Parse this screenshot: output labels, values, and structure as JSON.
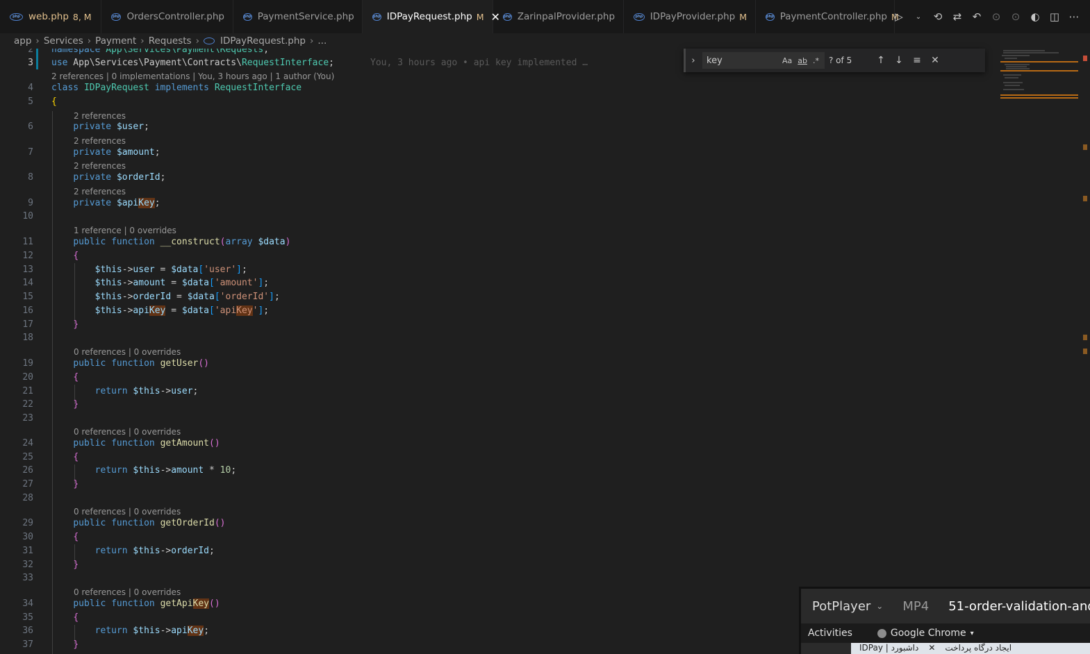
{
  "tabs": [
    {
      "title": "web.php",
      "modified": "8, M",
      "active": false,
      "mod_color": true
    },
    {
      "title": "OrdersController.php",
      "modified": "",
      "active": false
    },
    {
      "title": "PaymentService.php",
      "modified": "",
      "active": false
    },
    {
      "title": "IDPayRequest.php",
      "modified": "M",
      "active": true
    },
    {
      "title": "ZarinpalProvider.php",
      "modified": "",
      "active": false
    },
    {
      "title": "IDPayProvider.php",
      "modified": "M",
      "active": false
    },
    {
      "title": "PaymentController.php",
      "modified": "M",
      "active": false
    }
  ],
  "breadcrumb": {
    "items": [
      "app",
      "Services",
      "Payment",
      "Requests",
      "IDPayRequest.php",
      "..."
    ]
  },
  "find": {
    "query": "key",
    "count": "? of 5",
    "match_case": "Aa",
    "whole_word": "ab",
    "regex": ".*"
  },
  "editor": {
    "blame": "You, 3 hours ago • api key implemented …",
    "lenses": {
      "use_line": "2 references | 0 implementations | You, 3 hours ago | 1 author (You)",
      "two_refs": "2 references",
      "one_ref": "1 reference | 0 overrides",
      "zero_refs": "0 references | 0 overrides"
    }
  },
  "overlay": {
    "player": "PotPlayer",
    "format": "MP4",
    "title": "51-order-validation-and",
    "activities": "Activities",
    "browser": "Google Chrome",
    "tab1": "IDPay | داشبورد",
    "tab2": "ایجاد درگاه پرداخت"
  },
  "colors": {
    "accent": "#0078d4",
    "modified": "#e2c08d",
    "highlight": "#623315"
  }
}
